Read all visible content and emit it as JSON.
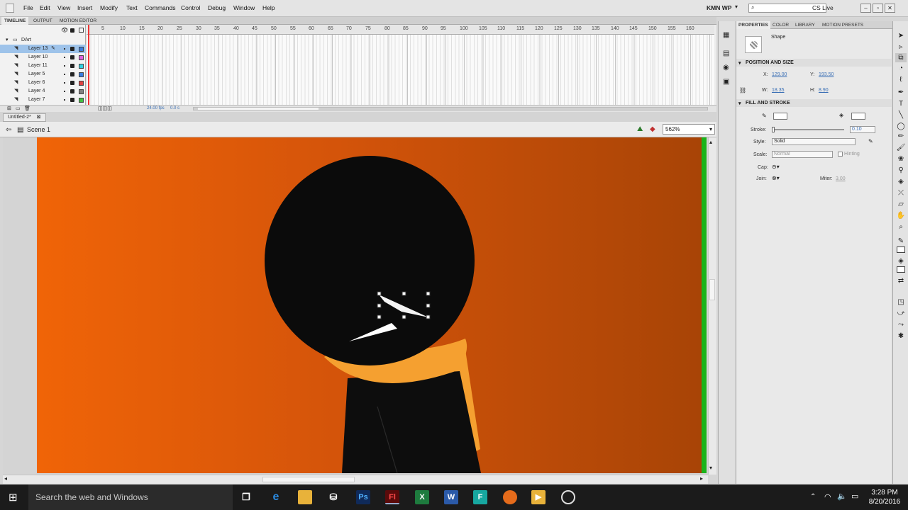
{
  "menubar": {
    "items": [
      "File",
      "Edit",
      "View",
      "Insert",
      "Modify",
      "Text",
      "Commands",
      "Control",
      "Debug",
      "Window",
      "Help"
    ],
    "workspace": "KMN WP",
    "cs_live": "CS Live"
  },
  "panel_tabs": [
    "TIMELINE",
    "OUTPUT",
    "MOTION EDITOR"
  ],
  "timeline": {
    "folder": "DArt",
    "layers": [
      "Layer 13",
      "Layer 10",
      "Layer 11",
      "Layer 5",
      "Layer 6",
      "Layer 4",
      "Layer 7"
    ],
    "layer_colors": [
      "#3a7de0",
      "#e060e0",
      "#30d0e0",
      "#3a7de0",
      "#e04040",
      "#808080",
      "#40c040"
    ],
    "frame_numbers": [
      "5",
      "10",
      "15",
      "20",
      "25",
      "30",
      "35",
      "40",
      "45",
      "50",
      "55",
      "60",
      "65",
      "70",
      "75",
      "80",
      "85",
      "90",
      "95",
      "100",
      "105",
      "110",
      "115",
      "120",
      "125",
      "130",
      "135",
      "140",
      "145",
      "150",
      "155",
      "160"
    ],
    "fps": "24.00 fps",
    "time": "0.0 s"
  },
  "document": {
    "tab": "Untitled-2*",
    "scene": "Scene 1",
    "zoom": "562%"
  },
  "properties": {
    "tabs": [
      "PROPERTIES",
      "COLOR",
      "LIBRARY",
      "MOTION PRESETS"
    ],
    "instance_type": "Shape",
    "position_section": "POSITION AND SIZE",
    "x_label": "X:",
    "x": "129.00",
    "y_label": "Y:",
    "y": "193.50",
    "w_label": "W:",
    "w": "18.35",
    "h_label": "H:",
    "h": "8.90",
    "fill_section": "FILL AND STROKE",
    "stroke_label": "Stroke:",
    "stroke": "0.10",
    "style_label": "Style:",
    "style": "Solid",
    "scale_label": "Scale:",
    "scale": "Normal",
    "hinting": "Hinting",
    "cap_label": "Cap:",
    "join_label": "Join:",
    "miter_label": "Miter:",
    "miter": "3.00"
  },
  "taskbar": {
    "search_placeholder": "Search the web and Windows",
    "time": "3:28 PM",
    "date": "8/20/2016"
  },
  "colors": {
    "stage_left": "#f06407",
    "stage_right": "#a84406",
    "scarf": "#f5a030",
    "head": "#0b0b0b"
  }
}
